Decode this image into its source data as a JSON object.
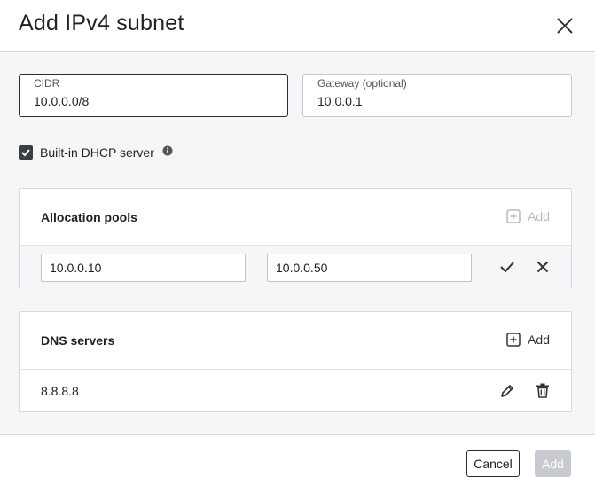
{
  "dialog": {
    "title": "Add IPv4 subnet"
  },
  "fields": {
    "cidr": {
      "label": "CIDR",
      "value": "10.0.0.0/8"
    },
    "gateway": {
      "label": "Gateway (optional)",
      "value": "10.0.0.1"
    }
  },
  "dhcp": {
    "label": "Built-in DHCP server",
    "checked": true
  },
  "allocation_pools": {
    "title": "Allocation pools",
    "add_label": "Add",
    "row": {
      "start": "10.0.0.10",
      "end": "10.0.0.50"
    }
  },
  "dns_servers": {
    "title": "DNS servers",
    "add_label": "Add",
    "items": [
      {
        "value": "8.8.8.8"
      }
    ]
  },
  "footer": {
    "cancel_label": "Cancel",
    "add_label": "Add"
  },
  "colors": {
    "primary_dark": "#2d2d2d",
    "disabled_button": "#c7cbcf",
    "panel_border": "#d6d9dc"
  }
}
